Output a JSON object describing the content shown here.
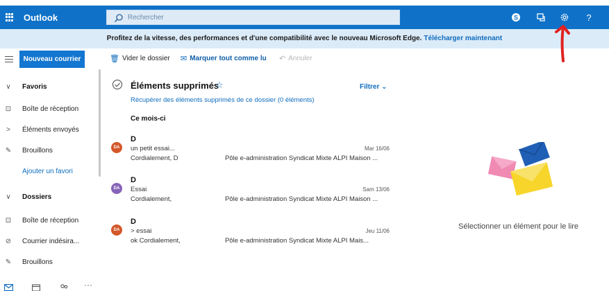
{
  "app": {
    "title": "Outlook"
  },
  "search": {
    "placeholder": "Rechercher"
  },
  "topbar_icons": [
    "skype-icon",
    "meet-now-icon",
    "settings-gear-icon",
    "help-icon"
  ],
  "banner": {
    "text": "Profitez de la vitesse, des performances et d'une compatibilité avec le nouveau Microsoft Edge.",
    "link": "Télécharger maintenant"
  },
  "colors": {
    "accent": "#0f72c8",
    "banner_bg": "#dcebf8",
    "link": "#0f6cbd",
    "annotation_arrow": "#e02222"
  },
  "left_pane": {
    "new_mail_label": "Nouveau courrier",
    "favorites_header": "Favoris",
    "favorites": [
      "Boîte de réception",
      "Éléments envoyés",
      "Brouillons"
    ],
    "add_favorite": "Ajouter un favori",
    "folders_header": "Dossiers",
    "folders": [
      "Boîte de réception",
      "Courrier indésira...",
      "Brouillons"
    ]
  },
  "toolbar": {
    "empty_folder": "Vider le dossier",
    "mark_all_read": "Marquer tout comme lu",
    "undo": "Annuler"
  },
  "list": {
    "folder_title": "Éléments supprimés",
    "filter_label": "Filtrer",
    "recover_link": "Récupérer des éléments supprimés de ce dossier (0 éléments)",
    "group_header": "Ce mois-ci",
    "messages": [
      {
        "avatar": "DA",
        "avatar_color": "#d4572a",
        "sender": "D",
        "subject": "un petit essai...",
        "date": "Mar 16/06",
        "preview": "Cordialement, D",
        "preview2": "Pôle e-administration Syndicat Mixte ALPI Maison ..."
      },
      {
        "avatar": "DA",
        "avatar_color": "#8764b8",
        "sender": "D",
        "subject": "Essai",
        "date": "Sam 13/06",
        "preview": "Cordialement,",
        "preview2": "Pôle e-administration Syndicat Mixte ALPI Maison ..."
      },
      {
        "avatar": "DA",
        "avatar_color": "#d4572a",
        "sender": "D",
        "subject": "> essai",
        "date": "Jeu 11/06",
        "preview": "ok Cordialement,",
        "preview2": "Pôle e-administration Syndicat Mixte ALPI Mais..."
      }
    ]
  },
  "reading_pane": {
    "empty_text": "Sélectionner un élément pour le lire"
  },
  "bottom_icons": [
    "mail-icon",
    "calendar-icon",
    "people-icon",
    "more-icon"
  ]
}
